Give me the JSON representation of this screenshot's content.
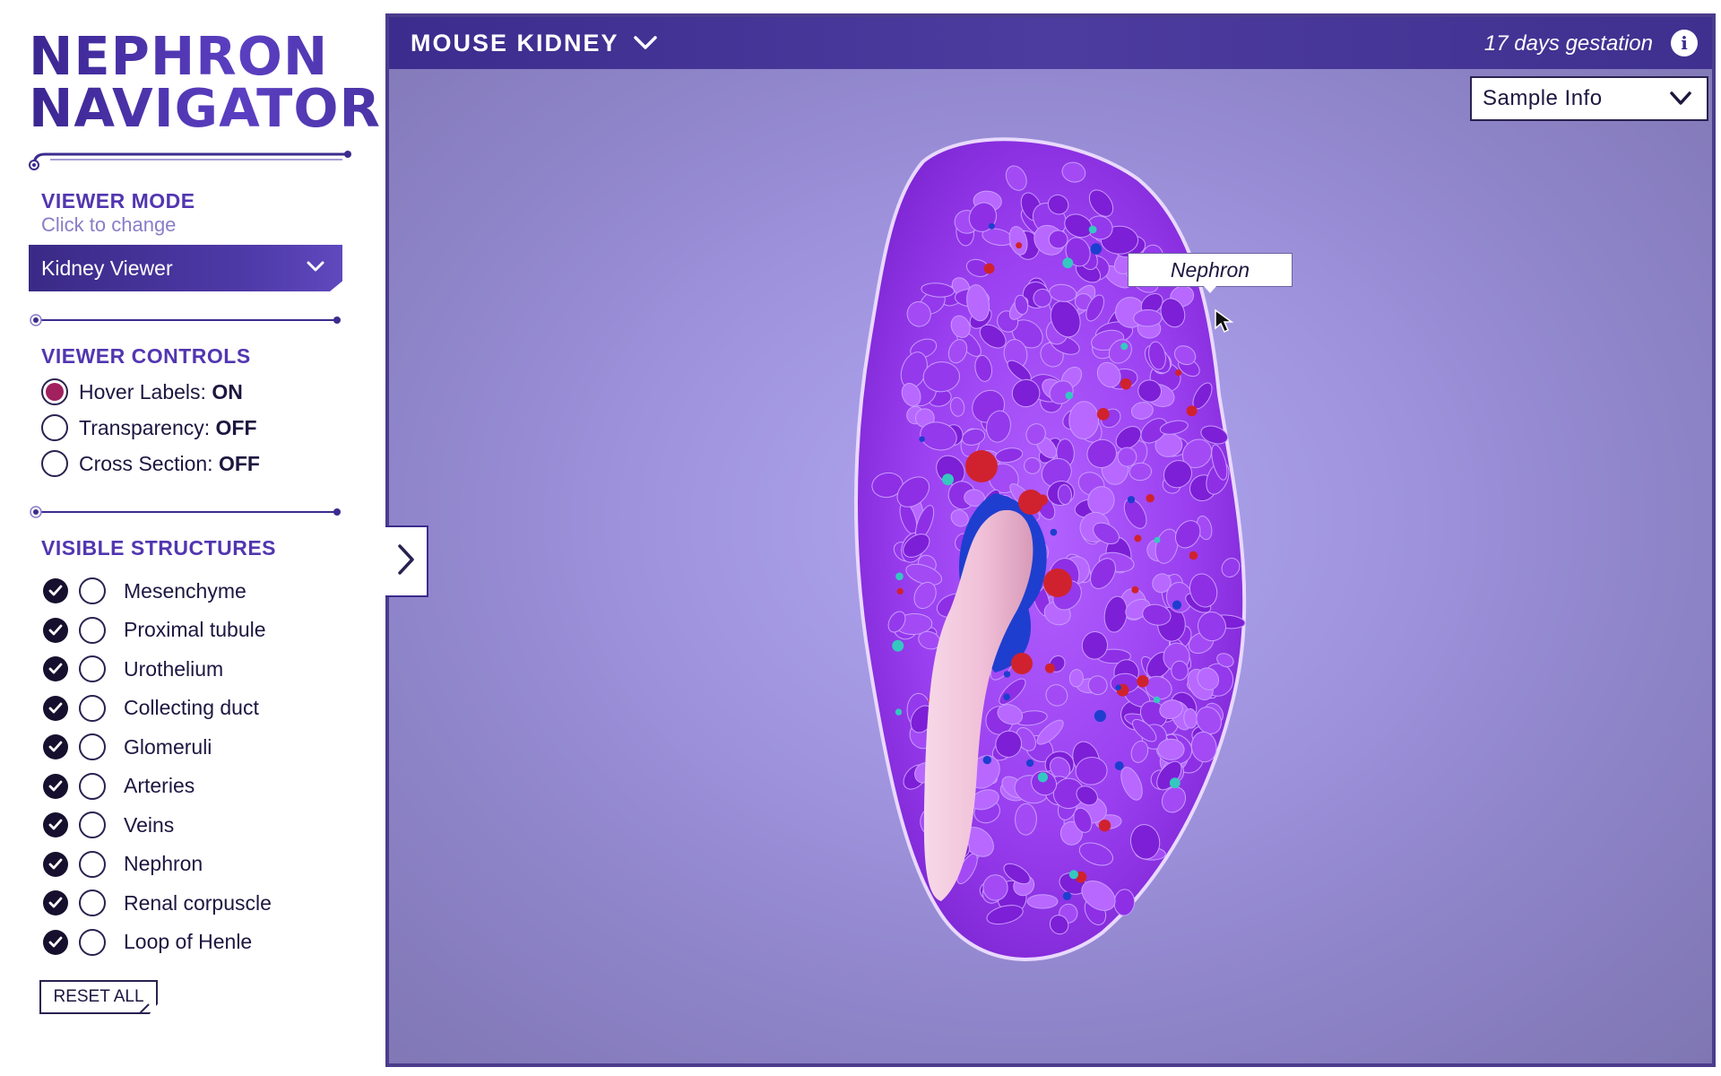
{
  "app": {
    "title_line1": "NEPHRON",
    "title_line2": "NAVIGATOR"
  },
  "viewer_mode": {
    "heading": "VIEWER MODE",
    "subheading": "Click to change",
    "selected": "Kidney Viewer",
    "chevron_icon": "chevron-down-icon"
  },
  "viewer_controls": {
    "heading": "VIEWER CONTROLS",
    "items": [
      {
        "label": "Hover Labels:",
        "state": "ON",
        "active": true
      },
      {
        "label": "Transparency:",
        "state": "OFF",
        "active": false
      },
      {
        "label": "Cross Section:",
        "state": "OFF",
        "active": false
      }
    ]
  },
  "visible_structures": {
    "heading": "VISIBLE STRUCTURES",
    "items": [
      {
        "label": "Mesenchyme",
        "checked": true
      },
      {
        "label": "Proximal tubule",
        "checked": true
      },
      {
        "label": "Urothelium",
        "checked": true
      },
      {
        "label": "Collecting duct",
        "checked": true
      },
      {
        "label": "Glomeruli",
        "checked": true
      },
      {
        "label": "Arteries",
        "checked": true
      },
      {
        "label": "Veins",
        "checked": true
      },
      {
        "label": "Nephron",
        "checked": true
      },
      {
        "label": "Renal corpuscle",
        "checked": true
      },
      {
        "label": "Loop of Henle",
        "checked": true
      }
    ],
    "reset_label": "RESET ALL"
  },
  "viewer": {
    "title": "MOUSE KIDNEY",
    "gestation": "17 days gestation",
    "info_icon": "info-icon",
    "sample_info_label": "Sample Info",
    "hover_label": "Nephron",
    "toggle_icon": "chevron-right-icon",
    "colors": {
      "nephron": "#9a3ff0",
      "urothelium": "#f2c4dc",
      "veins": "#1e3ecf",
      "arteries": "#d0222e",
      "collecting_duct": "#35c8c0",
      "header": "#3b2c8d",
      "accent": "#5236b0",
      "radio_on": "#a1205e"
    }
  }
}
